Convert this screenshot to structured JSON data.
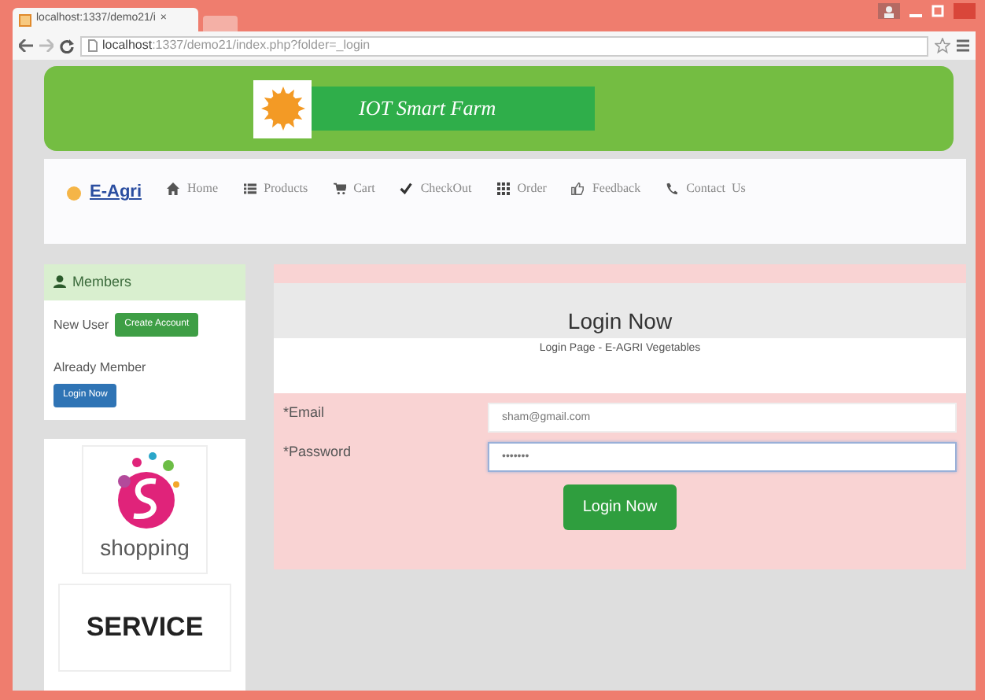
{
  "browser": {
    "tab_title": "localhost:1337/demo21/i",
    "tab_close": "×",
    "url_host": "localhost",
    "url_path": ":1337/demo21/index.php?folder=_login"
  },
  "banner": {
    "title": "IOT Smart Farm"
  },
  "navbar": {
    "brand": "E-Agri",
    "items": [
      {
        "label": "Home"
      },
      {
        "label": "Products"
      },
      {
        "label": "Cart"
      },
      {
        "label": "CheckOut"
      },
      {
        "label": "Order"
      },
      {
        "label": "Feedback"
      },
      {
        "label": "Contact  Us"
      }
    ]
  },
  "members": {
    "title": "Members",
    "new_user_label": "New User",
    "create_button": "Create Account",
    "member_label": "Already Member",
    "login_button": "Login Now"
  },
  "ads": {
    "shopping_text": "shopping",
    "service_text": "SERVICE"
  },
  "login": {
    "title": "Login Now",
    "subtitle": "Login Page - E-AGRI Vegetables",
    "fields": [
      {
        "label": "*Email",
        "value": "sham@gmail.com",
        "focused": false
      },
      {
        "label": "*Password",
        "value": "•••••••",
        "focused": true
      }
    ],
    "submit": "Login Now"
  }
}
